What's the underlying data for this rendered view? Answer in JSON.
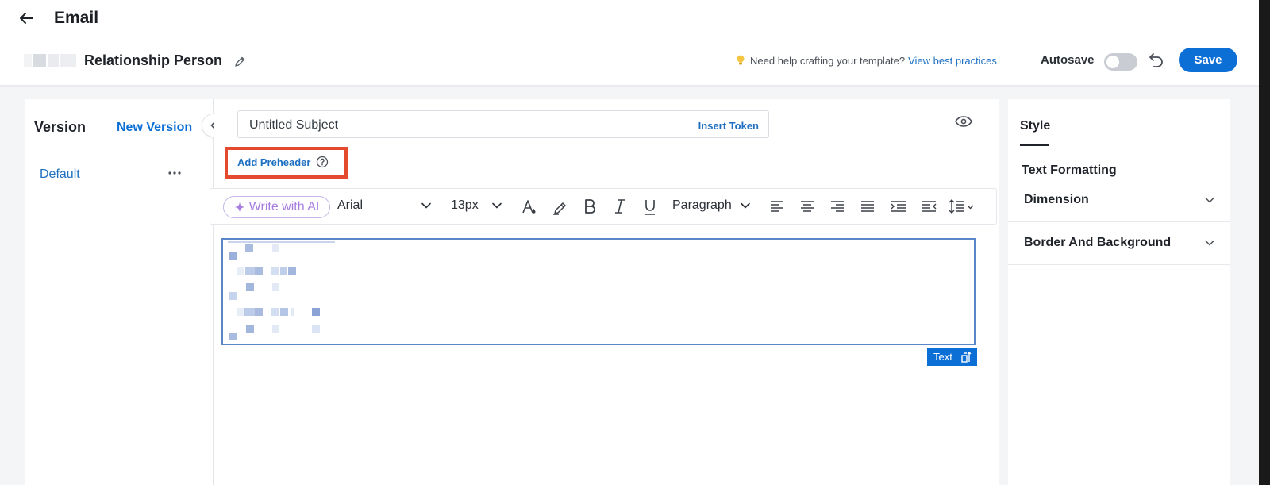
{
  "header": {
    "title": "Email"
  },
  "subheader": {
    "template_name": "Relationship Person",
    "help_text": "Need help crafting your template?",
    "help_link": "View best practices",
    "autosave_label": "Autosave",
    "autosave_on": false,
    "save_label": "Save"
  },
  "versions": {
    "title": "Version",
    "new_version_label": "New Version",
    "items": [
      {
        "label": "Default"
      }
    ]
  },
  "editor": {
    "subject_value": "Untitled Subject",
    "insert_token_label": "Insert Token",
    "preheader_label": "Add Preheader",
    "toolbar": {
      "ai_label": "Write with AI",
      "font_family": "Arial",
      "font_size": "13px",
      "block_format": "Paragraph"
    },
    "text_block_tag": "Text"
  },
  "style_panel": {
    "tab_label": "Style",
    "section_title": "Text Formatting",
    "accordions": [
      {
        "label": "Dimension"
      },
      {
        "label": "Border And Background"
      }
    ]
  },
  "colors": {
    "primary": "#0b6fd6",
    "link": "#1d6fc1",
    "highlight_box": "#e44a2e",
    "ai_purple": "#a77ee0"
  }
}
